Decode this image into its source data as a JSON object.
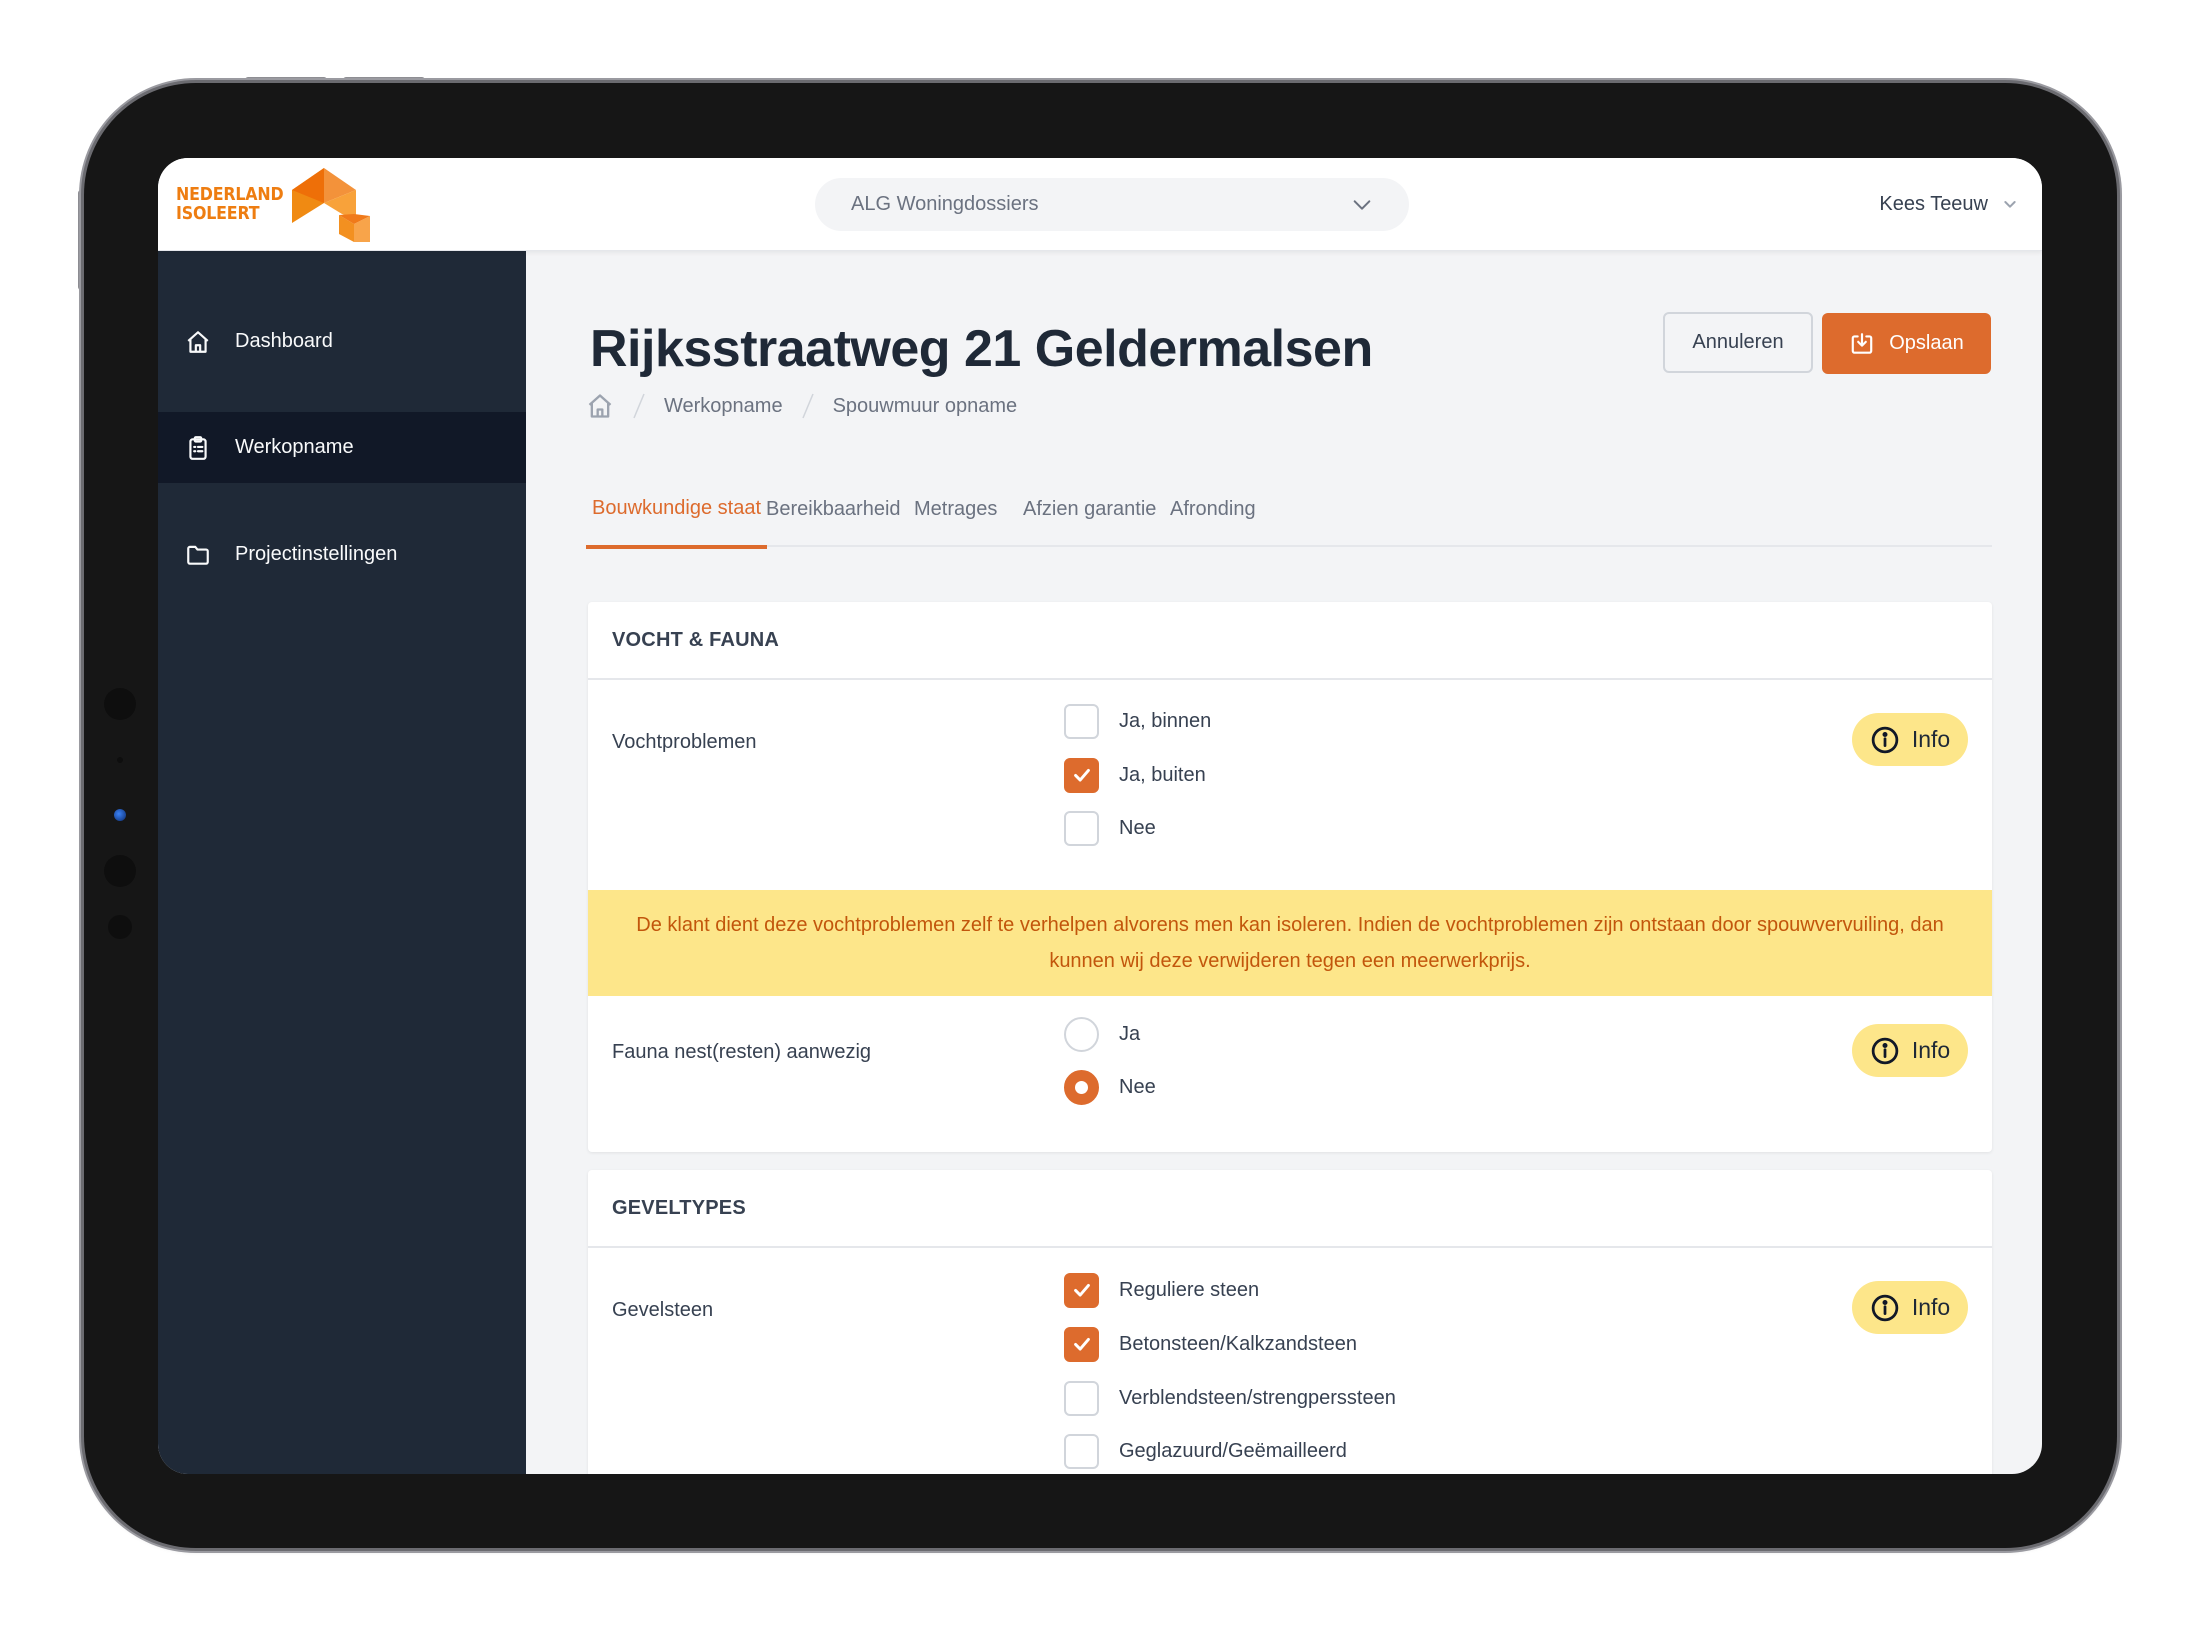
{
  "brand": {
    "line1": "NEDERLAND",
    "line2": "ISOLEERT",
    "primary_color": "#dd6b2d",
    "logo_color": "#ee7d11"
  },
  "header": {
    "site_select": {
      "value": "ALG Woningdossiers",
      "icon": "chevron-down-icon"
    },
    "user_menu": {
      "name": "Kees Teeuw",
      "icon": "chevron-down-icon"
    }
  },
  "sidebar": {
    "items": [
      {
        "label": "Dashboard",
        "icon": "home-icon",
        "active": false
      },
      {
        "label": "Werkopname",
        "icon": "clipboard-list-icon",
        "active": true
      },
      {
        "label": "Projectinstellingen",
        "icon": "folder-icon",
        "active": false
      }
    ]
  },
  "page": {
    "title": "Rijksstraatweg 21 Geldermalsen",
    "buttons": {
      "cancel": "Annuleren",
      "save": "Opslaan"
    },
    "breadcrumb": [
      "Werkopname",
      "Spouwmuur opname"
    ]
  },
  "tabs": [
    {
      "label": "Bouwkundige staat",
      "active": true
    },
    {
      "label": "Bereikbaarheid",
      "active": false
    },
    {
      "label": "Metrages",
      "active": false
    },
    {
      "label": "Afzien garantie",
      "active": false
    },
    {
      "label": "Afronding",
      "active": false
    }
  ],
  "sections": [
    {
      "title": "VOCHT & FAUNA",
      "fields": [
        {
          "label": "Vochtproblemen",
          "type": "checkbox",
          "info_label": "Info",
          "options": [
            {
              "label": "Ja, binnen",
              "checked": false
            },
            {
              "label": "Ja, buiten",
              "checked": true
            },
            {
              "label": "Nee",
              "checked": false
            }
          ],
          "alert": "De klant dient deze vochtproblemen zelf te verhelpen alvorens men kan isoleren. Indien de vochtproblemen zijn ontstaan door spouwvervuiling, dan kunnen wij deze verwijderen tegen een meerwerkprijs."
        },
        {
          "label": "Fauna nest(resten) aanwezig",
          "type": "radio",
          "info_label": "Info",
          "options": [
            {
              "label": "Ja",
              "checked": false
            },
            {
              "label": "Nee",
              "checked": true
            }
          ]
        }
      ]
    },
    {
      "title": "GEVELTYPES",
      "fields": [
        {
          "label": "Gevelsteen",
          "type": "checkbox",
          "info_label": "Info",
          "options": [
            {
              "label": "Reguliere steen",
              "checked": true
            },
            {
              "label": "Betonsteen/Kalkzandsteen",
              "checked": true
            },
            {
              "label": "Verblendsteen/strengperssteen",
              "checked": false
            },
            {
              "label": "Geglazuurd/Geëmailleerd",
              "checked": false
            }
          ]
        }
      ]
    }
  ]
}
